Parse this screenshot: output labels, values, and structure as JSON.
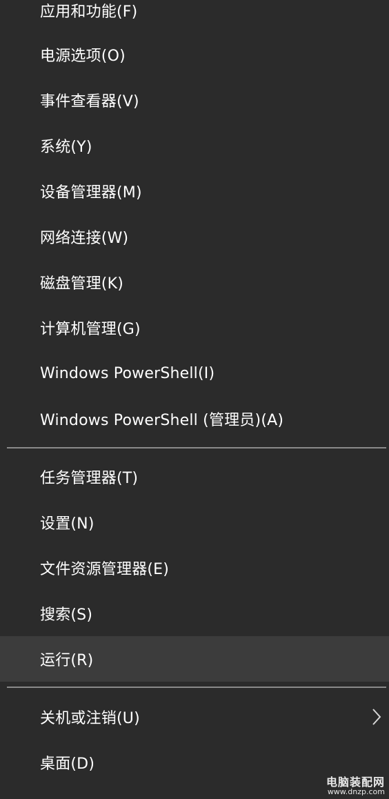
{
  "menu": {
    "items": [
      {
        "label": "应用和功能(F)"
      },
      {
        "label": "电源选项(O)"
      },
      {
        "label": "事件查看器(V)"
      },
      {
        "label": "系统(Y)"
      },
      {
        "label": "设备管理器(M)"
      },
      {
        "label": "网络连接(W)"
      },
      {
        "label": "磁盘管理(K)"
      },
      {
        "label": "计算机管理(G)"
      },
      {
        "label": "Windows PowerShell(I)"
      },
      {
        "label": "Windows PowerShell (管理员)(A)"
      },
      {
        "label": "任务管理器(T)"
      },
      {
        "label": "设置(N)"
      },
      {
        "label": "文件资源管理器(E)"
      },
      {
        "label": "搜索(S)"
      },
      {
        "label": "运行(R)",
        "highlighted": true
      },
      {
        "label": "关机或注销(U)",
        "submenu_icon": "chevron-right-icon"
      },
      {
        "label": "桌面(D)"
      }
    ]
  },
  "watermark": {
    "title": "电脑装配网",
    "url": "www.dnzp.com"
  },
  "colors": {
    "background": "#2b2b2b",
    "highlight": "#3c3c3c",
    "separator": "#8a8a8a",
    "text": "#ffffff"
  }
}
